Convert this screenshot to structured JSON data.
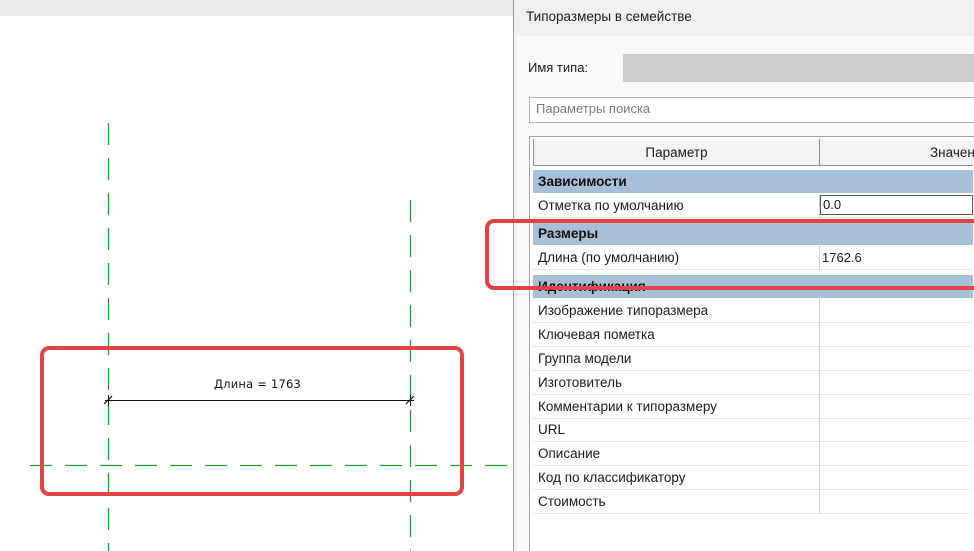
{
  "dialog": {
    "title": "Типоразмеры в семействе",
    "type_name_label": "Имя типа:",
    "type_name_value": "",
    "search_placeholder": "Параметры поиска"
  },
  "grid": {
    "headers": [
      "Параметр",
      "Значен"
    ],
    "groups": {
      "constraints": "Зависимости",
      "dimensions": "Размеры",
      "identity": "Идентификация"
    },
    "rows": {
      "default_elevation": {
        "name": "Отметка по умолчанию",
        "value": "0.0"
      },
      "length_default": {
        "name": "Длина (по умолчанию)",
        "value": "1762.6"
      },
      "type_image": {
        "name": "Изображение типоразмера",
        "value": ""
      },
      "keynote": {
        "name": "Ключевая пометка",
        "value": ""
      },
      "model_group": {
        "name": "Группа модели",
        "value": ""
      },
      "manufacturer": {
        "name": "Изготовитель",
        "value": ""
      },
      "type_comments": {
        "name": "Комментарии к типоразмеру",
        "value": ""
      },
      "url": {
        "name": "URL",
        "value": ""
      },
      "description": {
        "name": "Описание",
        "value": ""
      },
      "assembly_code": {
        "name": "Код по классификатору",
        "value": ""
      },
      "cost": {
        "name": "Стоимость",
        "value": ""
      }
    }
  },
  "canvas": {
    "dimension_label": "Длина = 1763"
  },
  "colors": {
    "highlight": "#e04343",
    "reference_line": "#1e9e2e",
    "group_header": "#a7c0da"
  }
}
